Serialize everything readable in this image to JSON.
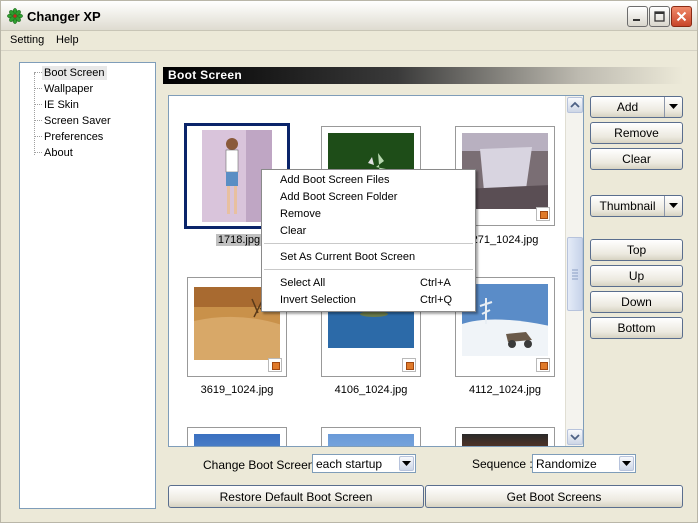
{
  "window": {
    "title": "Changer XP",
    "app_icon": "green-leaf-icon"
  },
  "menu": {
    "items": [
      "Setting",
      "Help"
    ]
  },
  "tree": {
    "items": [
      "Boot Screen",
      "Wallpaper",
      "IE Skin",
      "Screen Saver",
      "Preferences",
      "About"
    ],
    "selected": "Boot Screen"
  },
  "section": {
    "title": "Boot Screen"
  },
  "gallery": {
    "items": [
      {
        "name": "1718.jpg",
        "selected": true
      },
      {
        "name": "",
        "selected": false
      },
      {
        "name": "271_1024.jpg",
        "selected": false
      },
      {
        "name": "3619_1024.jpg",
        "selected": false
      },
      {
        "name": "4106_1024.jpg",
        "selected": false
      },
      {
        "name": "4112_1024.jpg",
        "selected": false
      }
    ]
  },
  "context_menu": {
    "items": [
      {
        "label": "Add Boot Screen Files",
        "shortcut": ""
      },
      {
        "label": "Add Boot Screen Folder",
        "shortcut": ""
      },
      {
        "label": "Remove",
        "shortcut": ""
      },
      {
        "label": "Clear",
        "shortcut": ""
      },
      {
        "label": "Set As Current Boot Screen",
        "shortcut": ""
      },
      {
        "label": "Select All",
        "shortcut": "Ctrl+A"
      },
      {
        "label": "Invert Selection",
        "shortcut": "Ctrl+Q"
      }
    ]
  },
  "buttons": {
    "add": "Add",
    "remove": "Remove",
    "clear": "Clear",
    "thumbnail": "Thumbnail",
    "top": "Top",
    "up": "Up",
    "down": "Down",
    "bottom": "Bottom",
    "restore": "Restore Default Boot Screen",
    "get": "Get Boot Screens"
  },
  "controls": {
    "change_label": "Change Boot Screen :",
    "change_value": "each startup",
    "sequence_label": "Sequence :",
    "sequence_value": "Randomize"
  },
  "colors": {
    "selection_border": "#0a246a",
    "header_gradient_start": "#000000"
  }
}
